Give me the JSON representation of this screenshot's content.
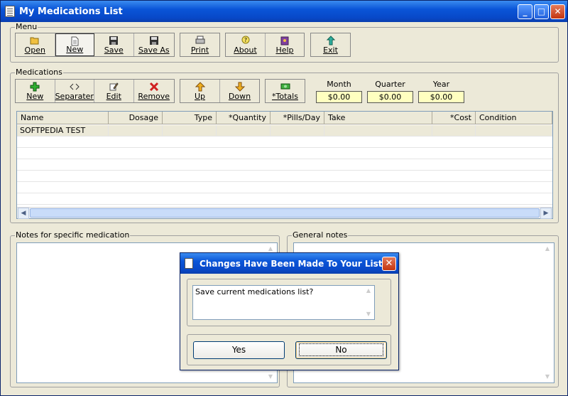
{
  "window": {
    "title": "My Medications List"
  },
  "menu": {
    "label": "Menu",
    "buttons": [
      {
        "label": "Open",
        "icon": "folder-open-icon"
      },
      {
        "label": "New",
        "icon": "new-document-icon"
      },
      {
        "label": "Save",
        "icon": "floppy-disk-icon"
      },
      {
        "label": "Save As",
        "icon": "floppy-disk-icon"
      },
      {
        "label": "Print",
        "icon": "printer-icon"
      },
      {
        "label": "About",
        "icon": "question-bulb-icon"
      },
      {
        "label": "Help",
        "icon": "help-book-icon"
      },
      {
        "label": "Exit",
        "icon": "exit-icon"
      }
    ]
  },
  "medications": {
    "label": "Medications",
    "buttons": [
      {
        "label": "New",
        "icon": "plus-icon"
      },
      {
        "label": "Separater",
        "icon": "diamond-icon"
      },
      {
        "label": "Edit",
        "icon": "edit-pencil-icon"
      },
      {
        "label": "Remove",
        "icon": "x-remove-icon"
      },
      {
        "label": "Up",
        "icon": "arrow-up-icon"
      },
      {
        "label": "Down",
        "icon": "arrow-down-icon"
      },
      {
        "label": "*Totals",
        "icon": "money-icon"
      }
    ],
    "totals": {
      "month": {
        "label": "Month",
        "value": "$0.00"
      },
      "quarter": {
        "label": "Quarter",
        "value": "$0.00"
      },
      "year": {
        "label": "Year",
        "value": "$0.00"
      }
    },
    "columns": [
      "Name",
      "Dosage",
      "Type",
      "*Quantity",
      "*Pills/Day",
      "Take",
      "*Cost",
      "Condition"
    ],
    "rows": [
      [
        "SOFTPEDIA TEST",
        "",
        "",
        "",
        "",
        "",
        "",
        ""
      ]
    ]
  },
  "notes": {
    "specific_label": "Notes for specific medication",
    "general_label": "General notes"
  },
  "dialog": {
    "title": "Changes Have Been Made To Your List",
    "message": "Save current medications list?",
    "yes_label": "Yes",
    "no_label": "No"
  }
}
